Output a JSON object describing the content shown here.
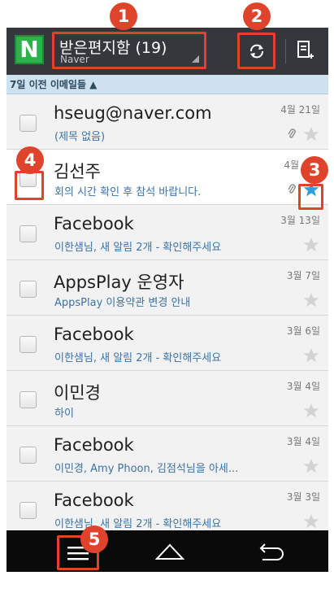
{
  "header": {
    "logo_letter": "N",
    "mailbox_title": "받은편지함 (19)",
    "mailbox_account": "Naver"
  },
  "section": {
    "label": "7일 이전 이메일들 ▲"
  },
  "emails": [
    {
      "sender": "hseug@naver.com",
      "subject": "(제목 없음)",
      "date": "4월 21일",
      "attachment": true,
      "starred": false,
      "read": true
    },
    {
      "sender": "김선주",
      "subject": "회의 시간 확인 후 참석 바랍니다.",
      "date": "4월",
      "attachment": true,
      "starred": true,
      "read": false
    },
    {
      "sender": "Facebook",
      "subject": "이한샘님, 새 알림 2개 - 확인해주세요",
      "date": "3월 13일",
      "attachment": false,
      "starred": false,
      "read": true
    },
    {
      "sender": "AppsPlay 운영자",
      "subject": "AppsPlay 이용약관 변경 안내",
      "date": "3월 7일",
      "attachment": false,
      "starred": false,
      "read": true
    },
    {
      "sender": "Facebook",
      "subject": "이한샘님, 새 알림 2개 - 확인해주세요",
      "date": "3월 6일",
      "attachment": false,
      "starred": false,
      "read": true
    },
    {
      "sender": "이민경",
      "subject": "하이",
      "date": "3월 4일",
      "attachment": false,
      "starred": false,
      "read": true
    },
    {
      "sender": "Facebook",
      "subject": "이민경, Amy Phoon, 김점석님을 아세...",
      "date": "3월 4일",
      "attachment": false,
      "starred": false,
      "read": true
    },
    {
      "sender": "Facebook",
      "subject": "이한샘님, 새 알림 2개 - 확인해주세요",
      "date": "3월 3일",
      "attachment": false,
      "starred": false,
      "read": true
    }
  ],
  "callouts": [
    "1",
    "2",
    "3",
    "4",
    "5"
  ],
  "icons": {
    "refresh": "refresh-icon",
    "compose": "compose-icon",
    "menu": "menu-icon",
    "home": "home-icon",
    "back": "back-icon",
    "star": "star-icon",
    "attachment": "paperclip-icon"
  },
  "colors": {
    "action_bar": "#34373c",
    "callout": "#e0432b",
    "section_header": "#cde1ef",
    "subject_text": "#3a73a6",
    "star_active": "#2e9fd8",
    "star_inactive": "#d3d3d3",
    "logo_green": "#2bb34a"
  }
}
